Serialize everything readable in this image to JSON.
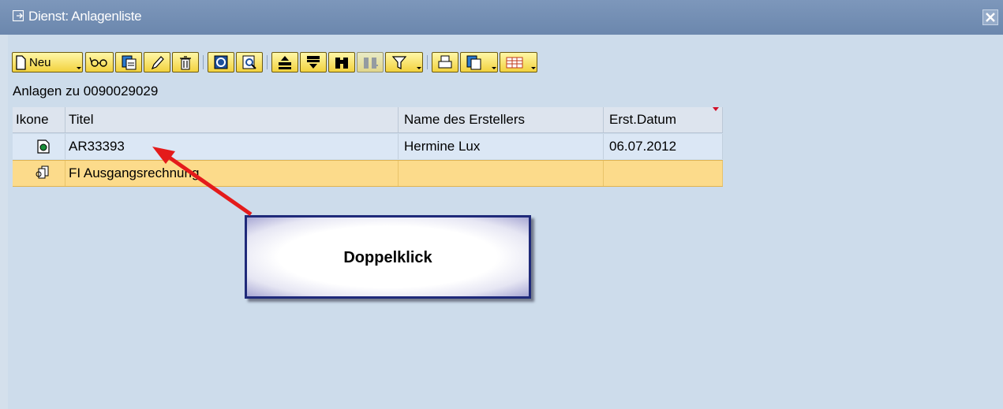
{
  "window": {
    "title": "Dienst: Anlagenliste",
    "title_icon": "exit-dialog-icon",
    "close_icon": "close-icon"
  },
  "toolbar": {
    "new_label": "Neu",
    "buttons": [
      "new-document-icon",
      "glasses-display-icon",
      "copy-icon",
      "pencil-edit-icon",
      "trash-delete-icon",
      "refresh-icon",
      "details-icon",
      "sort-ascending-icon",
      "sort-descending-icon",
      "find-binoculars-icon",
      "find-next-icon",
      "filter-icon",
      "print-icon",
      "export-icon",
      "layout-grid-icon"
    ]
  },
  "caption": "Anlagen zu 0090029029",
  "table": {
    "columns": [
      "Ikone",
      "Titel",
      "Name des Erstellers",
      "Erst.Datum"
    ],
    "rows": [
      {
        "icon": "document-attachment-icon",
        "title": "AR33393",
        "creator": "Hermine Lux",
        "date": "06.07.2012",
        "selected": false
      },
      {
        "icon": "folder-documents-icon",
        "title": "FI Ausgangsrechnung",
        "creator": "",
        "date": "",
        "selected": true
      }
    ]
  },
  "annotation": {
    "text": "Doppelklick",
    "arrow_color": "#e41b1b"
  },
  "colors": {
    "titlebar": "#6f8bb1",
    "background": "#cddceb",
    "toolbar_button": "#f6dd5c",
    "selected_row": "#fcdb8b",
    "callout_border": "#1f2a7a"
  }
}
